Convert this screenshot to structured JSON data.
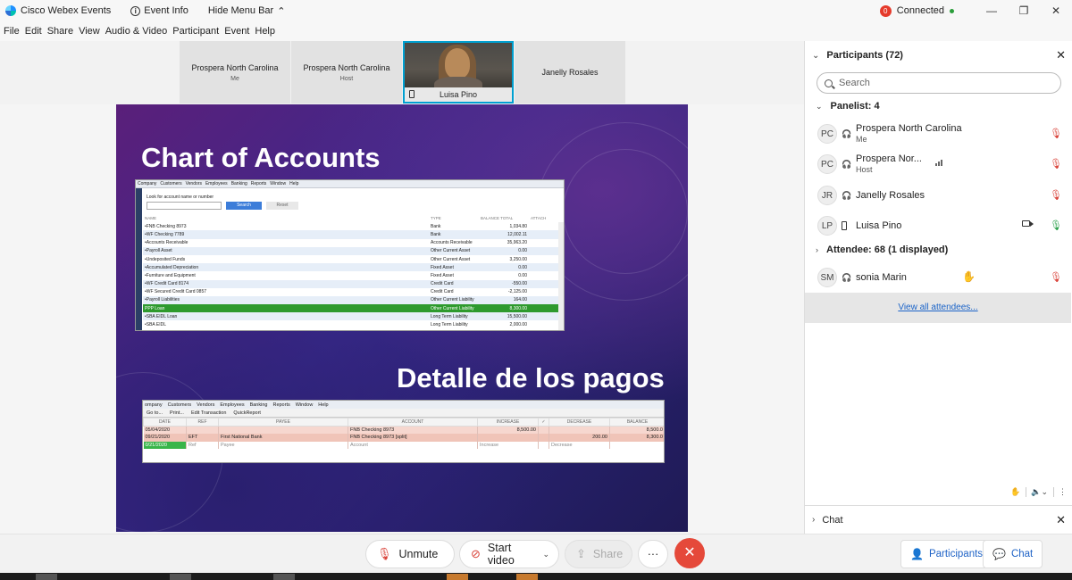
{
  "titlebar": {
    "app_name": "Cisco Webex Events",
    "event_info": "Event Info",
    "hide_menu_bar": "Hide Menu Bar",
    "notification_count": "0",
    "status": "Connected"
  },
  "menu": [
    "File",
    "Edit",
    "Share",
    "View",
    "Audio & Video",
    "Participant",
    "Event",
    "Help"
  ],
  "video_tiles": [
    {
      "name": "Prospera North Carolina",
      "sub": "Me"
    },
    {
      "name": "Prospera North Carolina",
      "sub": "Host"
    },
    {
      "name": "Luisa Pino",
      "sub": ""
    },
    {
      "name": "Janelly Rosales",
      "sub": ""
    }
  ],
  "slide": {
    "title1": "Chart of Accounts",
    "title2": "Detalle de los pagos",
    "qb1": {
      "menu": [
        "Company",
        "Customers",
        "Vendors",
        "Employees",
        "Banking",
        "Reports",
        "Window",
        "Help"
      ],
      "lookfor": "Look for account name or number",
      "search_btn": "Search",
      "reset_btn": "Reset",
      "headers": [
        "NAME",
        "TYPE",
        "BALANCE TOTAL",
        "ATTACH"
      ],
      "rows": [
        [
          "•FNB Checking 8973",
          "Bank",
          "1,034.80"
        ],
        [
          "•WF Checking 7789",
          "Bank",
          "12,002.11"
        ],
        [
          "•Accounts Receivable",
          "Accounts Receivable",
          "35,963.20"
        ],
        [
          "•Payroll Asset",
          "Other Current Asset",
          "0.00"
        ],
        [
          "•Undeposited Funds",
          "Other Current Asset",
          "3,250.00"
        ],
        [
          "•Accumulated Depreciation",
          "Fixed Asset",
          "0.00"
        ],
        [
          "•Furniture and Equipment",
          "Fixed Asset",
          "0.00"
        ],
        [
          "•WF Credit Card 8174",
          "Credit Card",
          "-550.00"
        ],
        [
          "•WF Secured Credit Card 0857",
          "Credit Card",
          "-2,125.00"
        ],
        [
          "•Payroll Liabilities",
          "Other Current Liability",
          "164.00"
        ],
        [
          "PPP Loan",
          "Other Current Liability",
          "8,300.00"
        ],
        [
          "•SBA EIDL Loan",
          "Long Term Liability",
          "15,500.00"
        ],
        [
          "•SBA EIDL",
          "Long Term Liability",
          "2,000.00"
        ]
      ]
    },
    "qb2": {
      "menu": [
        "ompany",
        "Customers",
        "Vendors",
        "Employees",
        "Banking",
        "Reports",
        "Window",
        "Help"
      ],
      "tools": [
        "Go to...",
        "Print...",
        "Edit Transaction",
        "QuickReport"
      ],
      "headers": [
        "DATE",
        "REF",
        "PAYEE",
        "ACCOUNT",
        "INCREASE",
        "✓",
        "DECREASE",
        "BALANCE"
      ],
      "rows": [
        [
          "05/04/2020",
          "",
          "",
          "FNB Checking 8973",
          "8,500.00",
          "",
          "",
          "8,500.0"
        ],
        [
          "09/21/2020",
          "EFT",
          "First National Bank",
          "FNB Checking 8973 [split]",
          "",
          "",
          "200.00",
          "8,300.0"
        ]
      ],
      "entry": [
        "0/21/2020",
        "Ref",
        "Payee",
        "Account",
        "Increase",
        "",
        "Decrease",
        ""
      ]
    }
  },
  "participants_panel": {
    "title": "Participants (72)",
    "search_placeholder": "Search",
    "panelist_group": "Panelist: 4",
    "panelists": [
      {
        "initials": "PC",
        "name": "Prospera North Carolina",
        "role": "Me"
      },
      {
        "initials": "PC",
        "name": "Prospera Nor...",
        "role": "Host"
      },
      {
        "initials": "JR",
        "name": "Janelly Rosales",
        "role": ""
      },
      {
        "initials": "LP",
        "name": "Luisa Pino",
        "role": ""
      }
    ],
    "attendee_group": "Attendee: 68 (1 displayed)",
    "attendees": [
      {
        "initials": "SM",
        "name": "sonia Marin"
      }
    ],
    "view_all": "View all attendees..."
  },
  "chat_panel": {
    "title": "Chat"
  },
  "bottom_bar": {
    "unmute": "Unmute",
    "start_video": "Start video",
    "share": "Share",
    "more": "···",
    "participants": "Participants",
    "chat": "Chat"
  },
  "colors": {
    "accent": "#1f63c6",
    "end_call": "#e5493a",
    "active_tile_border": "#00a0d1",
    "mute_red": "#d9433a"
  }
}
